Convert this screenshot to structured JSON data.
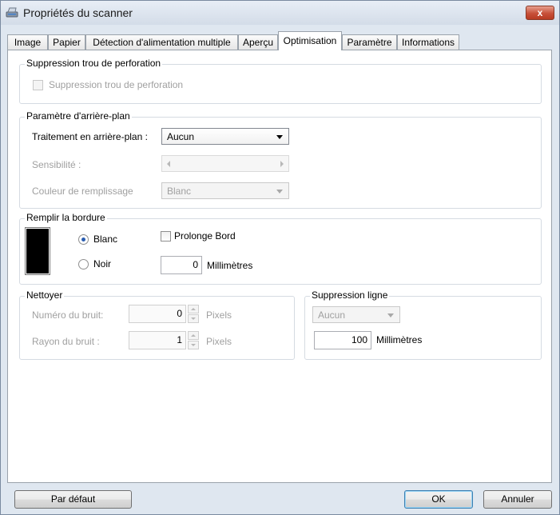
{
  "window": {
    "title": "Propriétés du scanner",
    "close": "x"
  },
  "tabs": [
    {
      "label": "Image"
    },
    {
      "label": "Papier"
    },
    {
      "label": "Détection d'alimentation multiple"
    },
    {
      "label": "Aperçu"
    },
    {
      "label": "Optimisation"
    },
    {
      "label": "Paramètre"
    },
    {
      "label": "Informations"
    }
  ],
  "active_tab": "Optimisation",
  "punch_hole": {
    "group_label": "Suppression trou de perforation",
    "checkbox_label": "Suppression trou de perforation",
    "checked": false,
    "enabled": false
  },
  "background": {
    "group_label": "Paramètre d'arrière-plan",
    "treatment_label": "Traitement en arrière-plan :",
    "treatment_value": "Aucun",
    "sensitivity_label": "Sensibilité :",
    "fill_color_label": "Couleur de remplissage",
    "fill_color_value": "Blanc"
  },
  "border": {
    "group_label": "Remplir la bordure",
    "white_label": "Blanc",
    "black_label": "Noir",
    "selected": "Blanc",
    "extend_label": "Prolonge Bord",
    "extend_checked": false,
    "value": "0",
    "unit": "Millimètres"
  },
  "clean": {
    "group_label": "Nettoyer",
    "noise_number_label": "Numéro du bruit:",
    "noise_number_value": "0",
    "noise_number_unit": "Pixels",
    "noise_radius_label": "Rayon du bruit :",
    "noise_radius_value": "1",
    "noise_radius_unit": "Pixels"
  },
  "line_removal": {
    "group_label": "Suppression ligne",
    "value": "Aucun",
    "length_value": "100",
    "length_unit": "Millimètres"
  },
  "buttons": {
    "default": "Par défaut",
    "ok": "OK",
    "cancel": "Annuler"
  }
}
